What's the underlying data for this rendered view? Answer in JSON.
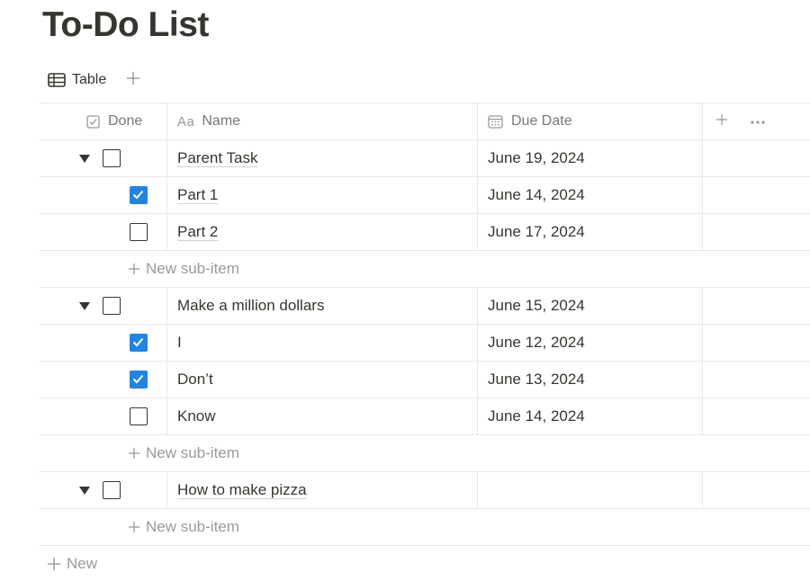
{
  "page": {
    "title": "To-Do List"
  },
  "views": [
    {
      "label": "Table",
      "icon": "table-icon"
    }
  ],
  "columns": {
    "done": "Done",
    "name_icon_text": "Aa",
    "name": "Name",
    "due_date": "Due Date"
  },
  "rows": [
    {
      "name": "Parent Task",
      "due": "June 19, 2024",
      "done": false
    },
    {
      "name": "Part 1",
      "due": "June 14, 2024",
      "done": true
    },
    {
      "name": "Part 2",
      "due": "June 17, 2024",
      "done": false
    },
    {
      "name": "Make a million dollars",
      "due": "June 15, 2024",
      "done": false
    },
    {
      "name": "I",
      "due": "June 12, 2024",
      "done": true
    },
    {
      "name": "Don’t",
      "due": "June 13, 2024",
      "done": true
    },
    {
      "name": "Know",
      "due": "June 14, 2024",
      "done": false
    },
    {
      "name": "How to make pizza",
      "due": "",
      "done": false
    }
  ],
  "actions": {
    "new_sub_item": "New sub-item",
    "new": "New"
  },
  "colors": {
    "checkbox_checked": "#2383e2",
    "text": "#37352f",
    "muted": "#9b9a97",
    "border": "#e9e9e7"
  }
}
